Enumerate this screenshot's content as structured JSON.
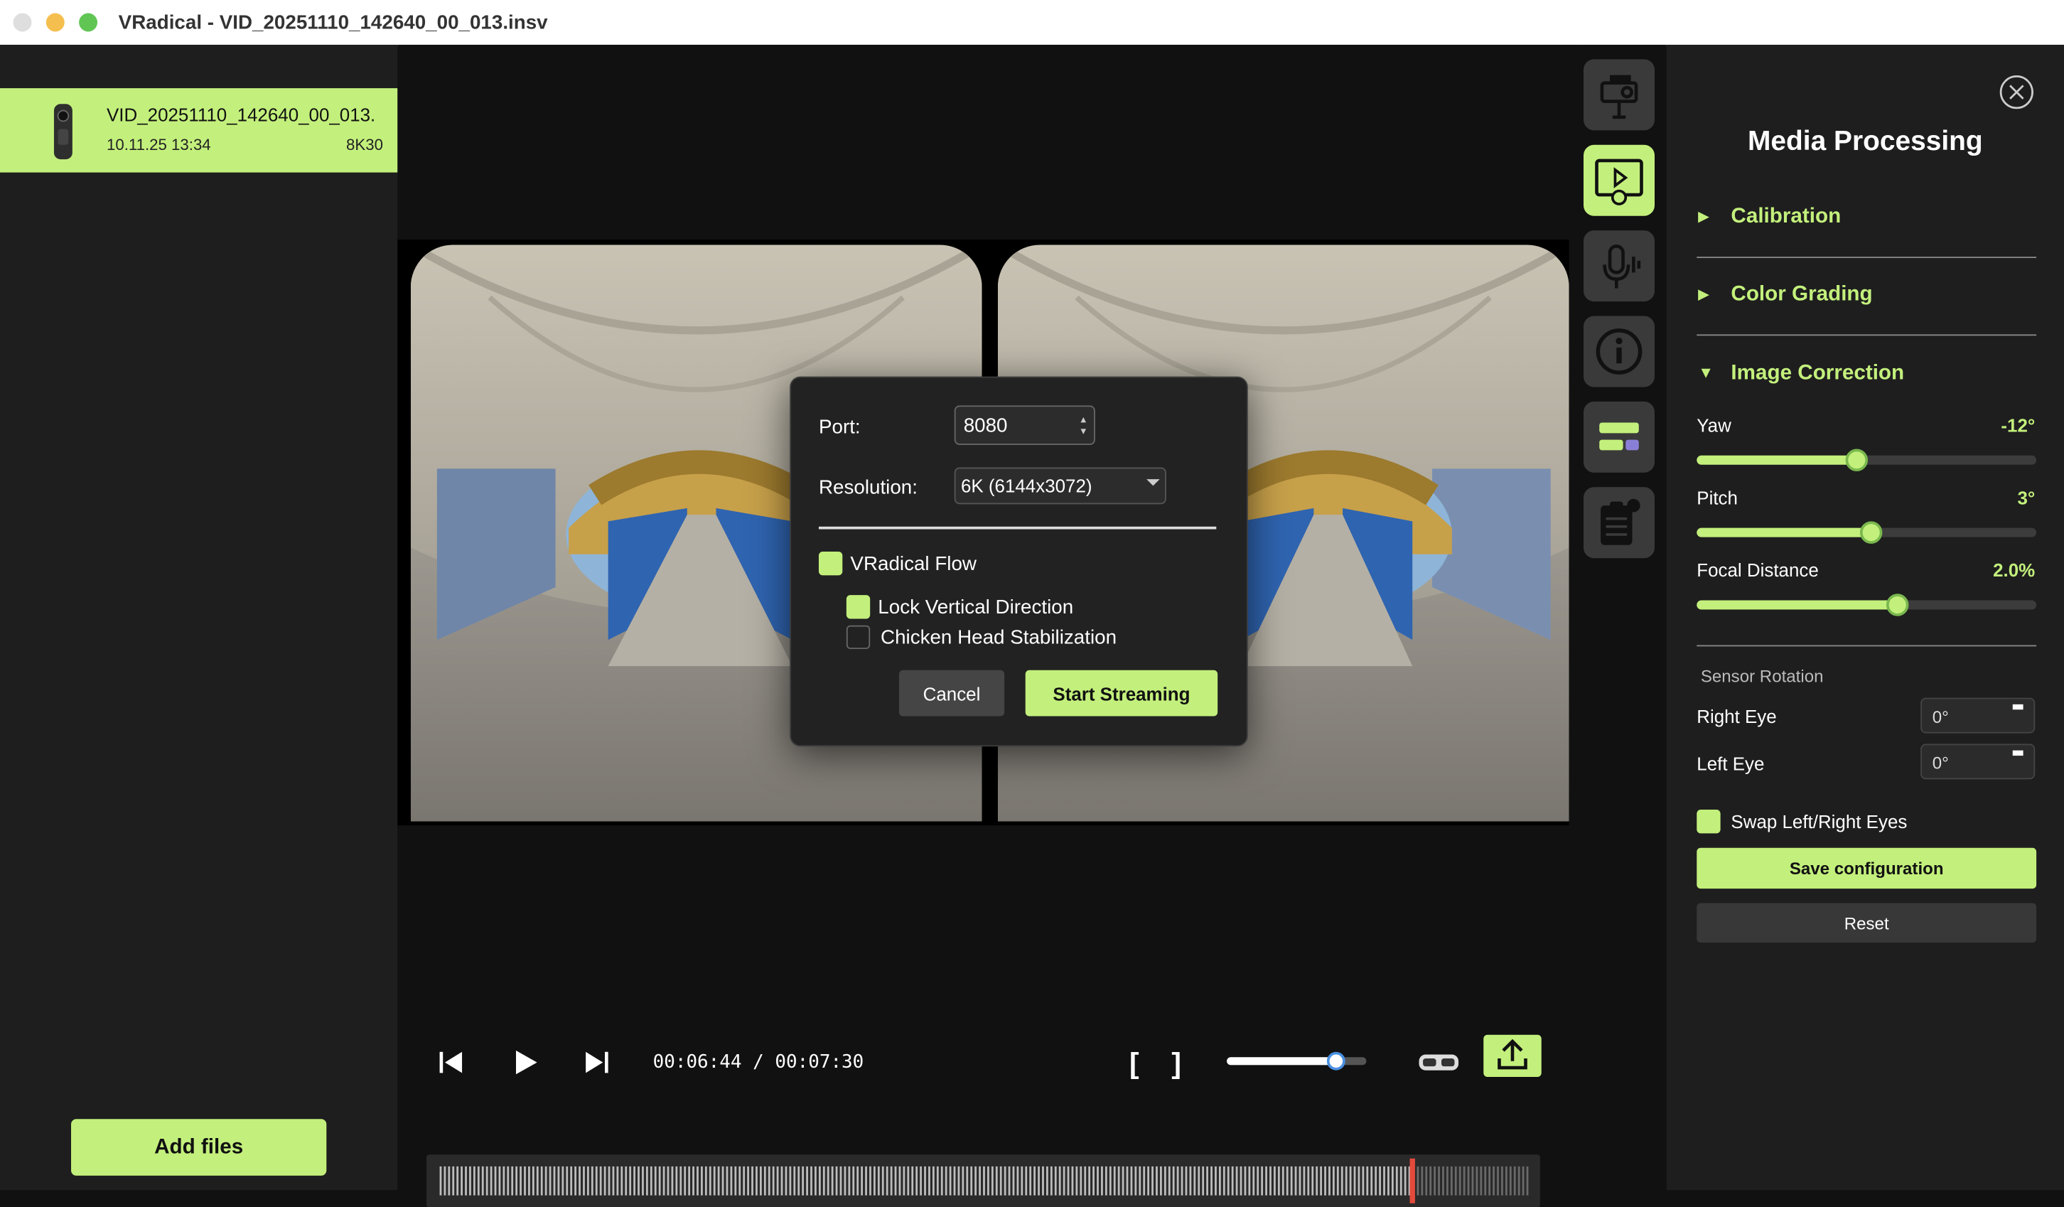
{
  "window": {
    "title": "VRadical - VID_20251110_142640_00_013.insv",
    "traffic_lights": {
      "close": "#dedede",
      "minimize": "#f5bf4f",
      "zoom": "#61c554"
    }
  },
  "file_list": {
    "items": [
      {
        "name": "VID_20251110_142640_00_013.",
        "date": "10.11.25 13:34",
        "format": "8K30",
        "selected": true
      }
    ],
    "add_files_label": "Add files"
  },
  "player": {
    "time_current": "00:06:44",
    "time_total": "00:07:30",
    "time_separator": "/",
    "mark_in": "[",
    "mark_out": "]",
    "volume": 0.78,
    "playhead": 0.895
  },
  "toolbar_icons": [
    "camera-icon",
    "media-processing-icon",
    "audio-icon",
    "info-icon",
    "layout-icon",
    "clipboard-icon"
  ],
  "panel": {
    "title": "Media Processing",
    "sections": {
      "calibration": "Calibration",
      "color_grading": "Color Grading",
      "image_correction": "Image Correction"
    },
    "sliders": {
      "yaw": {
        "label": "Yaw",
        "value": "-12°",
        "fraction": 0.47
      },
      "pitch": {
        "label": "Pitch",
        "value": "3°",
        "fraction": 0.51
      },
      "focal": {
        "label": "Focal Distance",
        "value": "2.0%",
        "fraction": 0.59
      }
    },
    "sensor_rotation": {
      "label": "Sensor Rotation",
      "right_eye": {
        "label": "Right Eye",
        "value": "0°"
      },
      "left_eye": {
        "label": "Left Eye",
        "value": "0°"
      }
    },
    "swap_eyes": {
      "label": "Swap Left/Right Eyes",
      "checked": true
    },
    "save_label": "Save configuration",
    "reset_label": "Reset"
  },
  "dialog": {
    "port_label": "Port:",
    "port_value": "8080",
    "resolution_label": "Resolution:",
    "resolution_value": "6K (6144x3072)",
    "vradical_flow": {
      "label": "VRadical Flow",
      "checked": true
    },
    "lock_vertical": {
      "label": "Lock Vertical Direction",
      "checked": true
    },
    "chicken_head": {
      "label": "Chicken Head Stabilization",
      "checked": false
    },
    "cancel_label": "Cancel",
    "start_label": "Start Streaming"
  },
  "colors": {
    "accent": "#c3f07c",
    "panel_bg": "#1e1e1e",
    "main_bg": "#111111",
    "playhead": "#e24a3b"
  }
}
